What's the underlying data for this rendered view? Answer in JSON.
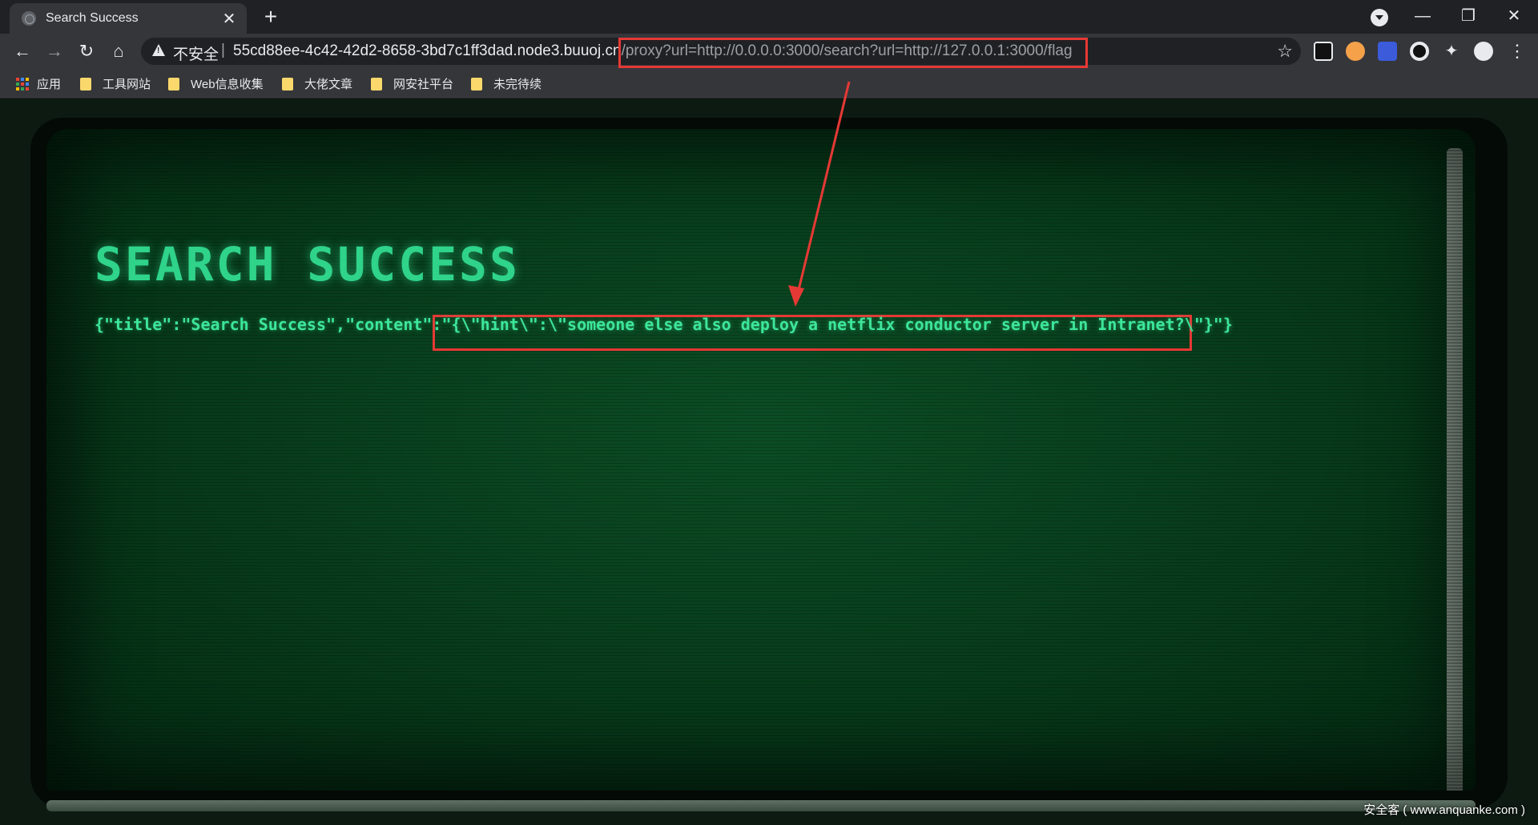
{
  "browser": {
    "tab": {
      "title": "Search Success"
    },
    "new_tab_glyph": "+",
    "window_controls": {
      "minimize": "—",
      "restore": "❐",
      "close": "✕"
    },
    "nav": {
      "back": "←",
      "forward": "→",
      "reload": "↻",
      "home": "⌂"
    },
    "omnibox": {
      "security_label": "不安全",
      "separator": "|",
      "host": "55cd88ee-4c42-42d2-8658-3bd7c1ff3dad.node3.buuoj.cn",
      "path": "/proxy?url=http://0.0.0.0:3000/search?url=http://127.0.0.1:3000/flag"
    },
    "bookmark_star": "☆",
    "extensions": [
      {
        "icon": "notion-icon",
        "color": "#111111"
      },
      {
        "icon": "puzzle-grid-icon",
        "color": "#f4a14a"
      },
      {
        "icon": "blue-bug-icon",
        "color": "#3b5bdb"
      },
      {
        "icon": "circle-icon",
        "color": "#111111"
      },
      {
        "icon": "extensions-puzzle-icon",
        "color": "#e8eaed"
      },
      {
        "icon": "profile-icon",
        "color": "#e8eaed"
      }
    ],
    "menu_glyph": "⋮",
    "bookmarks": [
      {
        "label": "应用",
        "type": "apps"
      },
      {
        "label": "工具网站",
        "type": "folder"
      },
      {
        "label": "Web信息收集",
        "type": "folder"
      },
      {
        "label": "大佬文章",
        "type": "folder"
      },
      {
        "label": "网安社平台",
        "type": "folder"
      },
      {
        "label": "未完待续",
        "type": "folder"
      }
    ]
  },
  "page": {
    "heading": "SEARCH SUCCESS",
    "json_text": {
      "prefix": "{\"title\":\"Search Success\",\"content\":\"",
      "highlight": "{\\\"hint\\\":\\\"someone else also deploy a netflix conductor server in Intranet?\\\"}",
      "suffix": "\"}"
    }
  },
  "annotation": {
    "color": "#e53935"
  },
  "watermark": "安全客 ( www.anquanke.com )",
  "colors": {
    "crt_text": "#3de69a",
    "tab_active": "#35363a",
    "frame": "#202124"
  }
}
